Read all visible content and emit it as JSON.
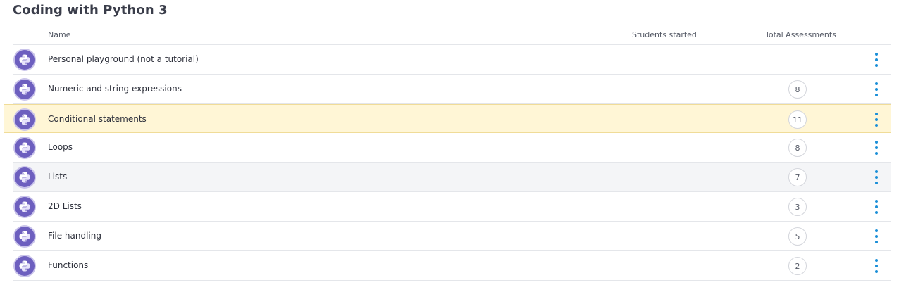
{
  "page": {
    "title": "Coding with Python 3"
  },
  "table": {
    "headers": {
      "name": "Name",
      "students_started": "Students started",
      "total_assessments": "Total Assessments"
    },
    "rows": [
      {
        "name": "Personal playground (not a tutorial)",
        "students_started": "",
        "total_assessments": ""
      },
      {
        "name": "Numeric and string expressions",
        "students_started": "",
        "total_assessments": "8"
      },
      {
        "name": "Conditional statements",
        "students_started": "",
        "total_assessments": "11"
      },
      {
        "name": "Loops",
        "students_started": "",
        "total_assessments": "8"
      },
      {
        "name": "Lists",
        "students_started": "",
        "total_assessments": "7"
      },
      {
        "name": "2D Lists",
        "students_started": "",
        "total_assessments": "3"
      },
      {
        "name": "File handling",
        "students_started": "",
        "total_assessments": "5"
      },
      {
        "name": "Functions",
        "students_started": "",
        "total_assessments": "2"
      }
    ]
  },
  "icons": {
    "row_icon": "python-logo-icon",
    "row_menu": "more-vertical-icon"
  },
  "colors": {
    "accent": "#1a8fd8",
    "icon_bg": "#6d5fbf",
    "highlight": "#fff6d6",
    "hover": "#f4f5f7"
  }
}
